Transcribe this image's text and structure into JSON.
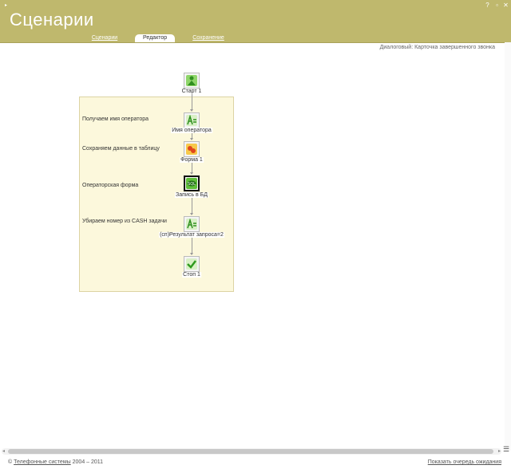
{
  "app": {
    "title": "Сценарии"
  },
  "tabs": [
    {
      "label": "Сценарии",
      "active": false
    },
    {
      "label": "Редактор",
      "active": true
    },
    {
      "label": "Сохранение",
      "active": false
    }
  ],
  "card_title": "Диалоговый: Карточка завершенного звонка",
  "diagram": {
    "nodes": [
      {
        "label": "Старт 1",
        "icon": "start-icon"
      },
      {
        "label": "Имя оператора",
        "icon": "assign-icon"
      },
      {
        "label": "Форма 1",
        "icon": "form-icon"
      },
      {
        "label": "Запись в БД",
        "icon": "db-write-icon"
      },
      {
        "label": "(сп)Результат запроса=2",
        "icon": "assign-icon"
      },
      {
        "label": "Стоп 1",
        "icon": "stop-check-icon"
      }
    ],
    "group_labels": [
      "Получаем имя оператора",
      "Сохраняем данные в таблицу",
      "Операторская форма",
      "Убираем номер из CASH задачи"
    ]
  },
  "footer": {
    "copyright": "©",
    "company_link": "Телефонные системы",
    "years": "2004 – 2011",
    "queue_link": "Показать очередь ожидания"
  }
}
